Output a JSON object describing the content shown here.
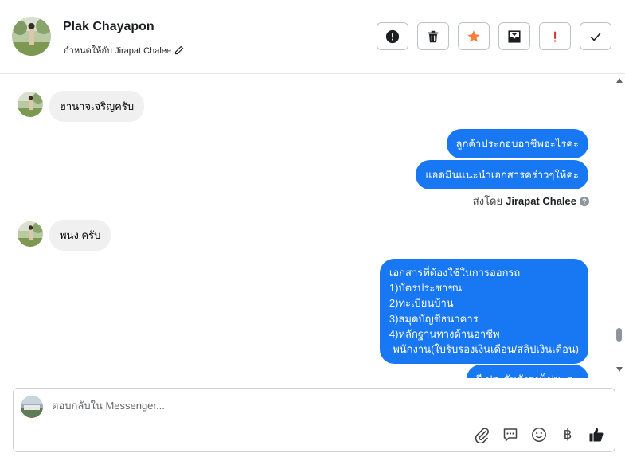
{
  "header": {
    "contact_name": "Plak Chayapon",
    "assigned_text": "กำหนดให้กับ Jirapat Chalee",
    "actions": [
      {
        "name": "report-icon",
        "label": "Mark as spam"
      },
      {
        "name": "trash-icon",
        "label": "Delete"
      },
      {
        "name": "star-icon",
        "label": "Star",
        "color": "#f5813a"
      },
      {
        "name": "archive-icon",
        "label": "Archive"
      },
      {
        "name": "exclamation-icon",
        "label": "Follow up",
        "color": "#d93025"
      },
      {
        "name": "check-icon",
        "label": "Done"
      }
    ]
  },
  "conversation": {
    "messages": [
      {
        "direction": "in",
        "text": "ฮานาจเจริญครับ"
      },
      {
        "direction": "out",
        "text": "ลูกค้าประกอบอาชีพอะไรคะ"
      },
      {
        "direction": "out",
        "text": "แอดมินแนะนำเอกสารคร่าวๆให้ค่ะ"
      },
      {
        "direction": "in",
        "text": "พนง ครับ"
      },
      {
        "direction": "out",
        "lines": [
          "เอกสารที่ต้องใช้ในการออกรถ",
          "1)บัตรประชาชน",
          "2)ทะเบียนบ้าน",
          "3)สมุดบัญชีธนาคาร",
          "4)หลักฐานทางด้านอาชีพ",
          "-พนักงาน(ใบรับรองเงินเดือน/สลิปเงินเดือน)"
        ]
      },
      {
        "direction": "out",
        "text": "ปี ประกันสังคมไปนะคะ"
      }
    ],
    "sent_by_prefix": "ส่งโดย",
    "sent_by_name": "Jirapat Chalee"
  },
  "composer": {
    "placeholder": "ตอบกลับใน Messenger...",
    "tools": [
      "paperclip-icon",
      "saved-reply-icon",
      "emoji-icon",
      "baht-icon",
      "thumbs-up-icon"
    ]
  },
  "colors": {
    "outgoing_bubble": "#1877f2",
    "incoming_bubble": "#f0f0f0"
  }
}
